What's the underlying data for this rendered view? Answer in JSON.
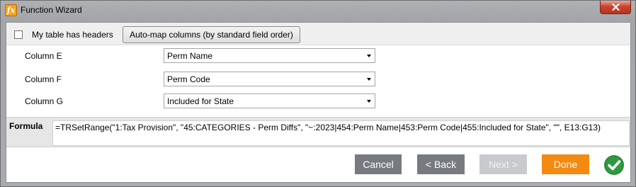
{
  "window": {
    "title": "Function Wizard",
    "app_icon_text": "fx"
  },
  "header": {
    "checkbox_label": "My table has headers",
    "checkbox_checked": false,
    "automap_label": "Auto-map columns (by standard field order)"
  },
  "mappings": [
    {
      "column": "Column E",
      "value": "Perm Name"
    },
    {
      "column": "Column F",
      "value": "Perm Code"
    },
    {
      "column": "Column G",
      "value": "Included for State"
    }
  ],
  "formula": {
    "label": "Formula",
    "text": "=TRSetRange(\"1:Tax Provision\", \"45:CATEGORIES - Perm Diffs\", \"~:2023|454:Perm Name|453:Perm Code|455:Included for State\", \"\", E13:G13)"
  },
  "footer": {
    "cancel_label": "Cancel",
    "back_label": "< Back",
    "next_label": "Next >",
    "next_enabled": false,
    "done_label": "Done"
  },
  "colors": {
    "accent_orange": "#f38a11",
    "ok_green": "#2a8a3a",
    "button_gray": "#777b80",
    "close_red": "#c9452f"
  },
  "icons": {
    "app": "fx-icon",
    "close": "close-icon",
    "ok": "checkmark-circle-icon",
    "dropdown": "caret-down-icon"
  }
}
